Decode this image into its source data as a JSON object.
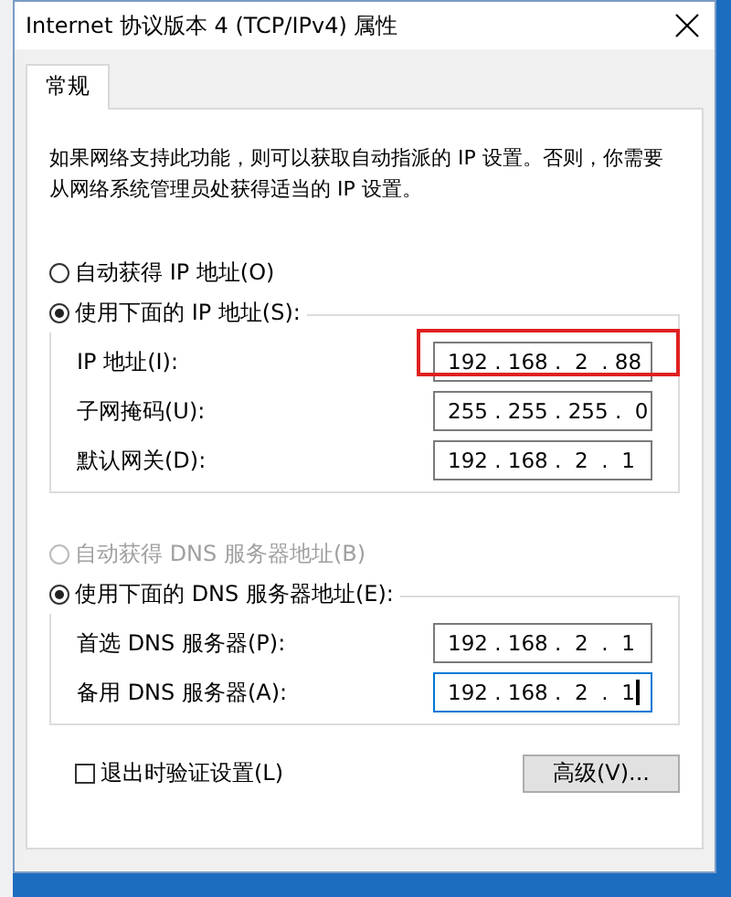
{
  "window": {
    "title": "Internet 协议版本 4 (TCP/IPv4) 属性"
  },
  "tabs": [
    {
      "label": "常规",
      "selected": true
    }
  ],
  "description": "如果网络支持此功能，则可以获取自动指派的 IP 设置。否则，你需要从网络系统管理员处获得适当的 IP 设置。",
  "ip_mode": [
    {
      "label": "自动获得 IP 地址(O)",
      "selected": false,
      "disabled": false
    },
    {
      "label": "使用下面的 IP 地址(S):",
      "selected": true,
      "disabled": false
    }
  ],
  "ip_fields": [
    {
      "label": "IP 地址(I):",
      "value": "192 . 168 .  2  . 88",
      "highlighted": true,
      "focused": false
    },
    {
      "label": "子网掩码(U):",
      "value": "255 . 255 . 255 .  0",
      "highlighted": false,
      "focused": false
    },
    {
      "label": "默认网关(D):",
      "value": "192 . 168 .  2  .  1",
      "highlighted": false,
      "focused": false
    }
  ],
  "dns_mode": [
    {
      "label": "自动获得 DNS 服务器地址(B)",
      "selected": false,
      "disabled": true
    },
    {
      "label": "使用下面的 DNS 服务器地址(E):",
      "selected": true,
      "disabled": false
    }
  ],
  "dns_fields": [
    {
      "label": "首选 DNS 服务器(P):",
      "value": "192 . 168 .  2  .  1",
      "highlighted": false,
      "focused": false
    },
    {
      "label": "备用 DNS 服务器(A):",
      "value": "192 . 168 .  2  .  1",
      "highlighted": false,
      "focused": true
    }
  ],
  "validate": {
    "label": "退出时验证设置(L)",
    "checked": false
  },
  "buttons": [
    {
      "label": "高级(V)..."
    }
  ]
}
